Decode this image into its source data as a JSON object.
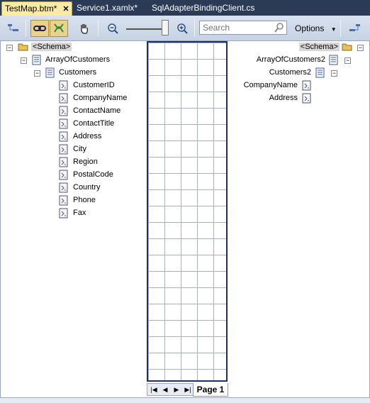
{
  "tabs": [
    {
      "label": "TestMap.btm*",
      "active": true
    },
    {
      "label": "Service1.xamlx*",
      "active": false
    },
    {
      "label": "SqlAdapterBindingClient.cs",
      "active": false
    }
  ],
  "toolbar": {
    "search_placeholder": "Search",
    "options_label": "Options"
  },
  "source_tree": {
    "root": "<Schema>",
    "array": "ArrayOfCustomers",
    "record": "Customers",
    "fields": [
      "CustomerID",
      "CompanyName",
      "ContactName",
      "ContactTitle",
      "Address",
      "City",
      "Region",
      "PostalCode",
      "Country",
      "Phone",
      "Fax"
    ]
  },
  "dest_tree": {
    "root": "<Schema>",
    "array": "ArrayOfCustomers2",
    "record": "Customers2",
    "fields": [
      "CompanyName",
      "Address"
    ]
  },
  "grid": {
    "page_label": "Page 1"
  },
  "colors": {
    "chrome": "#2b3a55",
    "active_tab": "#fbe9a7",
    "grid_border": "#1e2f6c"
  }
}
